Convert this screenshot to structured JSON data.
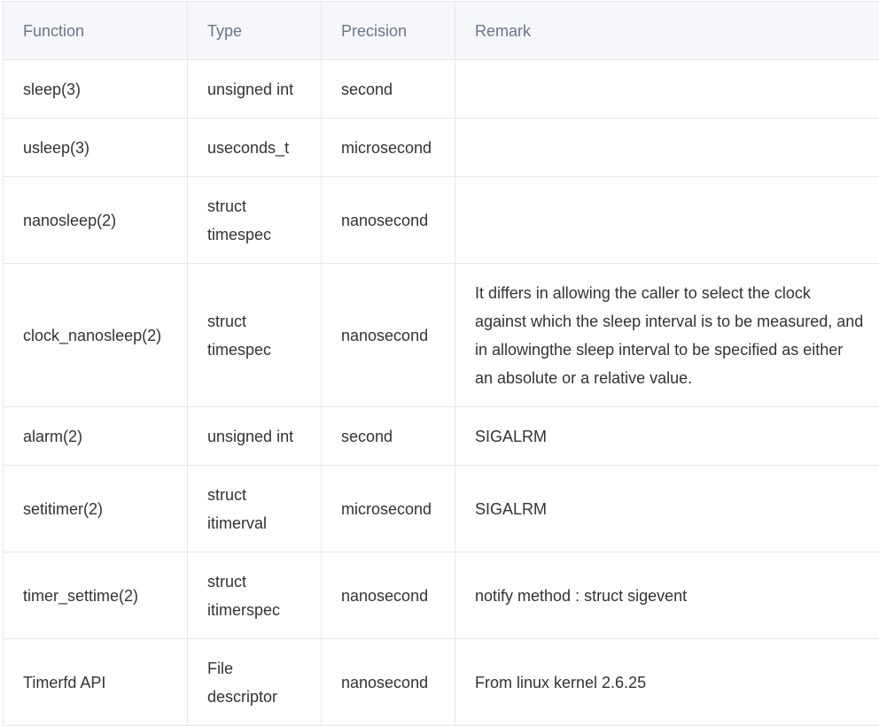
{
  "headers": [
    "Function",
    "Type",
    "Precision",
    "Remark"
  ],
  "rows": [
    {
      "function": "sleep(3)",
      "type": [
        "unsigned int"
      ],
      "precision": "second",
      "remark": ""
    },
    {
      "function": "usleep(3)",
      "type": [
        "useconds_t"
      ],
      "precision": "microsecond",
      "remark": ""
    },
    {
      "function": "nanosleep(2)",
      "type": [
        "struct",
        "timespec"
      ],
      "precision": "nanosecond",
      "remark": ""
    },
    {
      "function": "clock_nanosleep(2)",
      "type": [
        "struct",
        "timespec"
      ],
      "precision": "nanosecond",
      "remark": "It differs in allowing the caller to select the clock against which the sleep interval is to be measured, and in allowingthe sleep interval to be specified as either an absolute or a relative value."
    },
    {
      "function": "alarm(2)",
      "type": [
        "unsigned int"
      ],
      "precision": "second",
      "remark": "SIGALRM"
    },
    {
      "function": "setitimer(2)",
      "type": [
        "struct",
        "itimerval"
      ],
      "precision": "microsecond",
      "remark": "SIGALRM"
    },
    {
      "function": "timer_settime(2)",
      "type": [
        "struct",
        "itimerspec"
      ],
      "precision": "nanosecond",
      "remark": "notify method : struct sigevent"
    },
    {
      "function": "Timerfd API",
      "type": [
        "File",
        "descriptor"
      ],
      "precision": "nanosecond",
      "remark": "From linux kernel 2.6.25"
    }
  ]
}
